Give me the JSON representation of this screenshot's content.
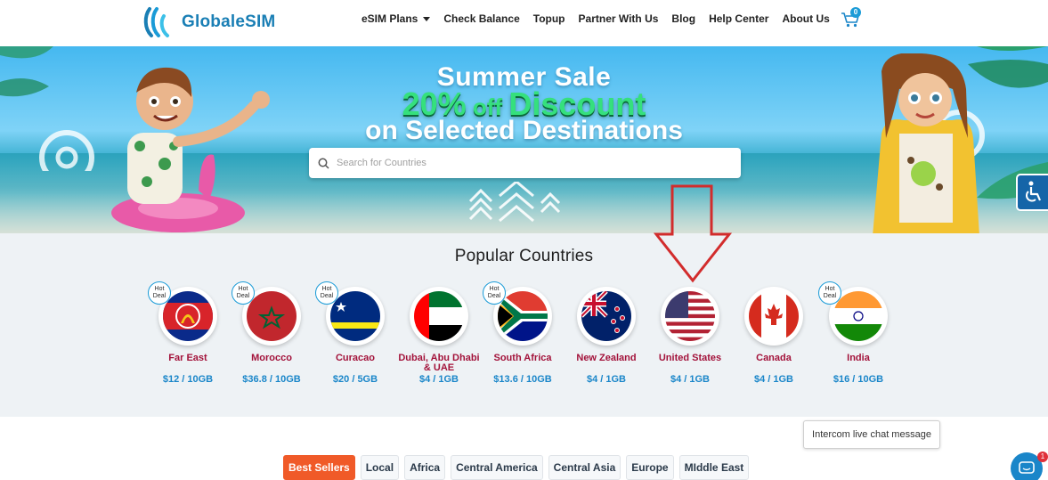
{
  "header": {
    "logo_text": "GlobaleSIM",
    "nav": [
      {
        "label": "eSIM Plans",
        "dropdown": true
      },
      {
        "label": "Check Balance"
      },
      {
        "label": "Topup"
      },
      {
        "label": "Partner With Us"
      },
      {
        "label": "Blog"
      },
      {
        "label": "Help Center"
      },
      {
        "label": "About Us"
      }
    ],
    "cart_count": "0"
  },
  "banner": {
    "line1": "Summer Sale",
    "line2_prefix": "20%",
    "line2_mid": " off ",
    "line2_word": "Discount",
    "line3": "on Selected Destinations",
    "search_placeholder": "Search for Countries"
  },
  "popular": {
    "title": "Popular Countries",
    "hot_label": "Hot Deal",
    "countries": [
      {
        "name": "Far East",
        "price": "$12 / 10GB",
        "hot": true
      },
      {
        "name": "Morocco",
        "price": "$36.8 / 10GB",
        "hot": true
      },
      {
        "name": "Curacao",
        "price": "$20 / 5GB",
        "hot": true
      },
      {
        "name": "Dubai, Abu Dhabi & UAE",
        "price": "$4 / 1GB",
        "hot": false
      },
      {
        "name": "South Africa",
        "price": "$13.6 / 10GB",
        "hot": true
      },
      {
        "name": "New Zealand",
        "price": "$4 / 1GB",
        "hot": false
      },
      {
        "name": "United States",
        "price": "$4 / 1GB",
        "hot": false
      },
      {
        "name": "Canada",
        "price": "$4 / 1GB",
        "hot": false
      },
      {
        "name": "India",
        "price": "$16 / 10GB",
        "hot": true
      }
    ]
  },
  "chat_tooltip": "Intercom live chat message",
  "intercom_badge": "1",
  "tabs": [
    "Best Sellers",
    "Local",
    "Africa",
    "Central America",
    "Central Asia",
    "Europe",
    "MIddle East"
  ],
  "colors": {
    "brand": "#1a7fb5",
    "country_name": "#a3123a",
    "price": "#1a86c9",
    "active_tab": "#f05a28",
    "discount_green": "#35e07d"
  }
}
